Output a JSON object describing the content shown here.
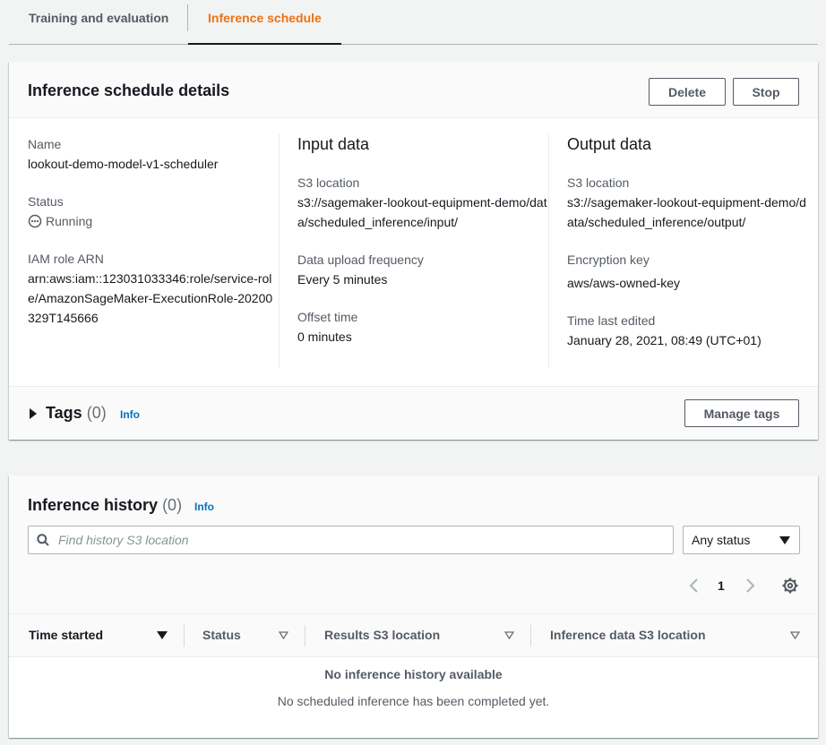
{
  "tabs": [
    {
      "label": "Training and evaluation"
    },
    {
      "label": "Inference schedule"
    }
  ],
  "details": {
    "title": "Inference schedule details",
    "delete_label": "Delete",
    "stop_label": "Stop",
    "general": {
      "name_label": "Name",
      "name_value": "lookout-demo-model-v1-scheduler",
      "status_label": "Status",
      "status_value": "Running",
      "role_label": "IAM role ARN",
      "role_value": "arn:aws:iam::123031033346:role/service-role/AmazonSageMaker-ExecutionRole-20200329T145666"
    },
    "input": {
      "title": "Input data",
      "s3_label": "S3 location",
      "s3_value": "s3://sagemaker-lookout-equipment-demo/data/scheduled_inference/input/",
      "freq_label": "Data upload frequency",
      "freq_value": "Every 5 minutes",
      "offset_label": "Offset time",
      "offset_value": "0 minutes"
    },
    "output": {
      "title": "Output data",
      "s3_label": "S3 location",
      "s3_value": "s3://sagemaker-lookout-equipment-demo/data/scheduled_inference/output/",
      "enc_label": "Encryption key",
      "enc_value": "aws/aws-owned-key",
      "edited_label": "Time last edited",
      "edited_value": "January 28, 2021, 08:49 (UTC+01)"
    },
    "tags": {
      "title": "Tags",
      "count": "(0)",
      "info": "Info",
      "manage_label": "Manage tags"
    }
  },
  "history": {
    "title": "Inference history",
    "count": "(0)",
    "info": "Info",
    "search_placeholder": "Find history S3 location",
    "status_filter": "Any status",
    "page": "1",
    "columns": [
      "Time started",
      "Status",
      "Results S3 location",
      "Inference data S3 location"
    ],
    "empty_title": "No inference history available",
    "empty_sub": "No scheduled inference has been completed yet."
  },
  "colors": {
    "accent": "#ec7211",
    "link": "#0073bb",
    "text": "#16191f",
    "muted": "#545b64"
  }
}
